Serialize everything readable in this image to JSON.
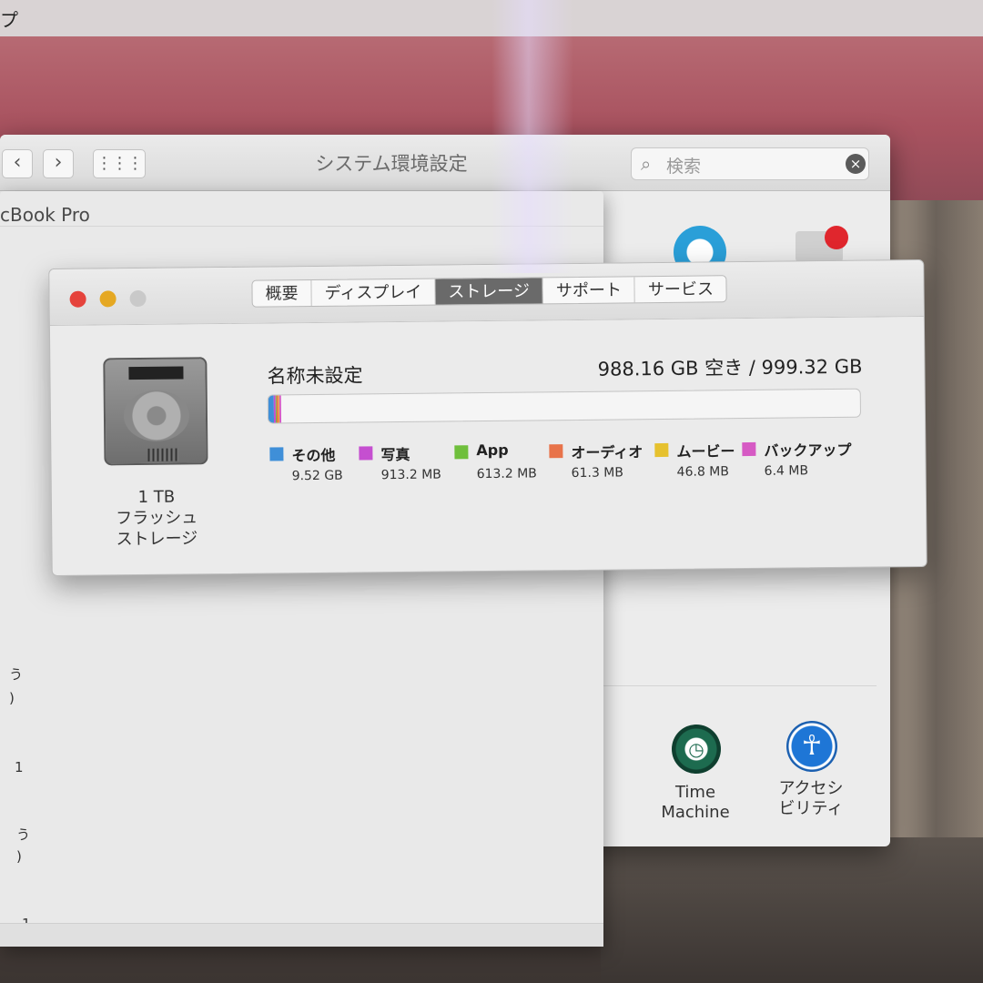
{
  "menubar": {
    "app_fragment": "プ"
  },
  "system_preferences": {
    "title": "システム環境設定",
    "back_label": "‹",
    "forward_label": "›",
    "grid_label": "⋮⋮⋮",
    "search": {
      "placeholder": "検索"
    },
    "icons": {
      "time_machine_label_1": "Time",
      "time_machine_label_2": "Machine",
      "accessibility_label_1": "アクセシ",
      "accessibility_label_2": "ビリティ"
    }
  },
  "about_mac": {
    "title_fragment": "cBook Pro",
    "fragments": [
      "う",
      ")",
      "1",
      "う",
      ")",
      "1"
    ]
  },
  "storage_window": {
    "tabs": [
      {
        "label": "概要",
        "active": false
      },
      {
        "label": "ディスプレイ",
        "active": false
      },
      {
        "label": "ストレージ",
        "active": true
      },
      {
        "label": "サポート",
        "active": false
      },
      {
        "label": "サービス",
        "active": false
      }
    ],
    "disk": {
      "capacity": "1 TB",
      "type_line1": "フラッシュ",
      "type_line2": "ストレージ"
    },
    "volume_name": "名称未設定",
    "free_summary": "988.16 GB 空き / 999.32 GB",
    "total_gb": 999.32,
    "legend": [
      {
        "name": "その他",
        "size": "9.52 GB",
        "gb": 9.52,
        "color": "#3f8fd8"
      },
      {
        "name": "写真",
        "size": "913.2 MB",
        "gb": 0.9132,
        "color": "#c54fd0"
      },
      {
        "name": "App",
        "size": "613.2 MB",
        "gb": 0.6132,
        "color": "#6fbf3c"
      },
      {
        "name": "オーディオ",
        "size": "61.3 MB",
        "gb": 0.0613,
        "color": "#e8734a"
      },
      {
        "name": "ムービー",
        "size": "46.8 MB",
        "gb": 0.0468,
        "color": "#e6c12e"
      },
      {
        "name": "バックアップ",
        "size": "6.4 MB",
        "gb": 0.0064,
        "color": "#d65ac4"
      }
    ]
  }
}
